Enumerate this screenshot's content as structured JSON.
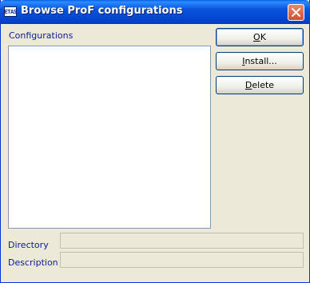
{
  "window": {
    "title": "Browse ProF configurations",
    "icon_text": "ETAS",
    "icon": "app-icon",
    "close_icon": "close-icon"
  },
  "configurations": {
    "label": "Configurations",
    "items": []
  },
  "buttons": {
    "ok": "OK",
    "install": "Install...",
    "delete": "Delete"
  },
  "directory": {
    "label": "Directory",
    "value": ""
  },
  "description": {
    "label": "Description",
    "value": ""
  }
}
